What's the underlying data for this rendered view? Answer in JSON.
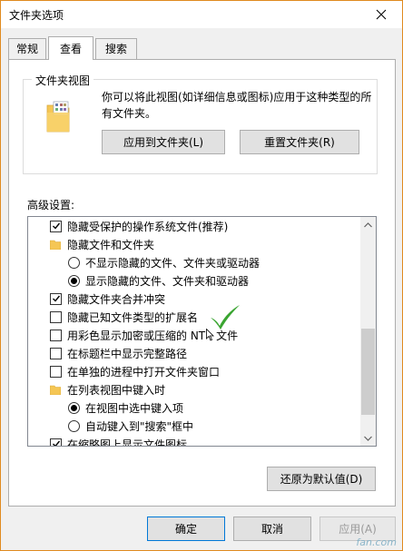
{
  "window": {
    "title": "文件夹选项"
  },
  "tabs": [
    {
      "label": "常规"
    },
    {
      "label": "查看"
    },
    {
      "label": "搜索"
    }
  ],
  "folder_views": {
    "legend": "文件夹视图",
    "description": "你可以将此视图(如详细信息或图标)应用于这种类型的所有文件夹。",
    "apply_button": "应用到文件夹(L)",
    "reset_button": "重置文件夹(R)"
  },
  "advanced": {
    "label": "高级设置:",
    "items": [
      {
        "type": "checkbox",
        "checked": true,
        "label": "隐藏受保护的操作系统文件(推荐)"
      },
      {
        "type": "folder",
        "label": "隐藏文件和文件夹"
      },
      {
        "type": "radio",
        "selected": false,
        "label": "不显示隐藏的文件、文件夹或驱动器"
      },
      {
        "type": "radio",
        "selected": true,
        "label": "显示隐藏的文件、文件夹和驱动器"
      },
      {
        "type": "checkbox",
        "checked": true,
        "label": "隐藏文件夹合并冲突"
      },
      {
        "type": "checkbox",
        "checked": false,
        "label": "隐藏已知文件类型的扩展名"
      },
      {
        "type": "checkbox",
        "checked": false,
        "label": "用彩色显示加密或压缩的 NT",
        "label_suffix": "文件"
      },
      {
        "type": "checkbox",
        "checked": false,
        "label": "在标题栏中显示完整路径"
      },
      {
        "type": "checkbox",
        "checked": false,
        "label": "在单独的进程中打开文件夹窗口"
      },
      {
        "type": "folder",
        "label": "在列表视图中键入时"
      },
      {
        "type": "radio",
        "selected": true,
        "label": "在视图中选中键入项"
      },
      {
        "type": "radio",
        "selected": false,
        "label": "自动键入到\"搜索\"框中"
      },
      {
        "type": "checkbox",
        "checked": true,
        "label": "在缩略图上显示文件图标"
      }
    ]
  },
  "restore_button": "还原为默认值(D)",
  "footer": {
    "ok": "确定",
    "cancel": "取消",
    "apply": "应用(A)"
  },
  "watermark": "fan.com",
  "colors": {
    "accent": "#0078d7",
    "checkmark": "#3aa531",
    "window_border": "#e08a1e"
  }
}
